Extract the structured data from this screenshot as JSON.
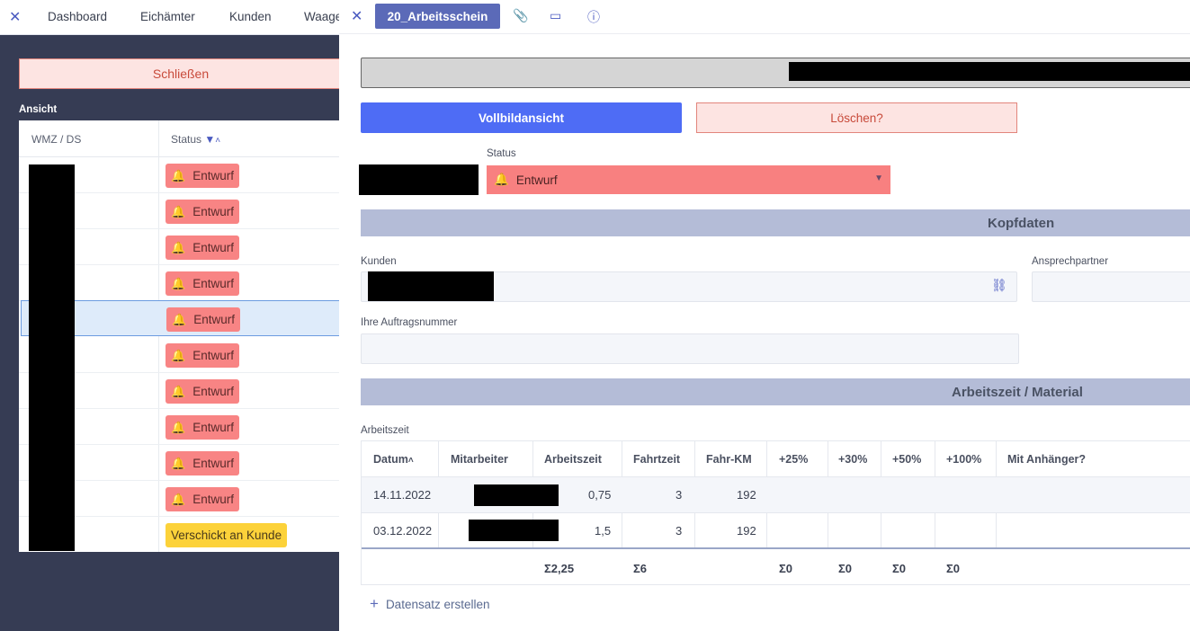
{
  "topnav": {
    "close_icon": "close-icon",
    "items": [
      "Dashboard",
      "Eichämter",
      "Kunden",
      "Waage"
    ]
  },
  "left": {
    "close_label": "Schließen",
    "view_label": "Ansicht",
    "table": {
      "col1": "WMZ / DS",
      "col2": "Status",
      "rows": [
        {
          "status": "Entwurf"
        },
        {
          "status": "Entwurf"
        },
        {
          "status": "Entwurf"
        },
        {
          "status": "Entwurf"
        },
        {
          "status": "Entwurf"
        },
        {
          "status": "Entwurf"
        },
        {
          "status": "Entwurf"
        },
        {
          "status": "Entwurf"
        },
        {
          "status": "Entwurf"
        },
        {
          "status": "Entwurf"
        },
        {
          "status": "Verschickt an Kunde"
        }
      ]
    }
  },
  "panel": {
    "tab_label": "20_Arbeitsschein",
    "fullscreen_label": "Vollbildansicht",
    "delete_label": "Löschen?",
    "status_label": "Status",
    "status_value": "Entwurf",
    "section_head": "Kopfdaten",
    "customer_label": "Kunden",
    "contact_label": "Ansprechpartner",
    "order_label": "Ihre Auftragsnummer",
    "section_work": "Arbeitszeit / Material",
    "worktime_label": "Arbeitszeit",
    "work_table": {
      "headers": [
        "Datum",
        "Mitarbeiter",
        "Arbeitszeit",
        "Fahrtzeit",
        "Fahr-KM",
        "+25%",
        "+30%",
        "+50%",
        "+100%",
        "Mit Anhänger?"
      ],
      "rows": [
        {
          "date": "14.11.2022",
          "worktime": "0,75",
          "drivetime": "3",
          "km": "192"
        },
        {
          "date": "03.12.2022",
          "worktime": "1,5",
          "drivetime": "3",
          "km": "192"
        }
      ],
      "sums": {
        "worktime": "Σ2,25",
        "drivetime": "Σ6",
        "p25": "Σ0",
        "p30": "Σ0",
        "p50": "Σ0",
        "p100": "Σ0"
      }
    },
    "create_label": "Datensatz erstellen"
  },
  "colors": {
    "accent": "#4e6cf5",
    "status_draft": "#f88484",
    "status_sent": "#fcd23a",
    "section_bg": "#b4bcd7"
  }
}
